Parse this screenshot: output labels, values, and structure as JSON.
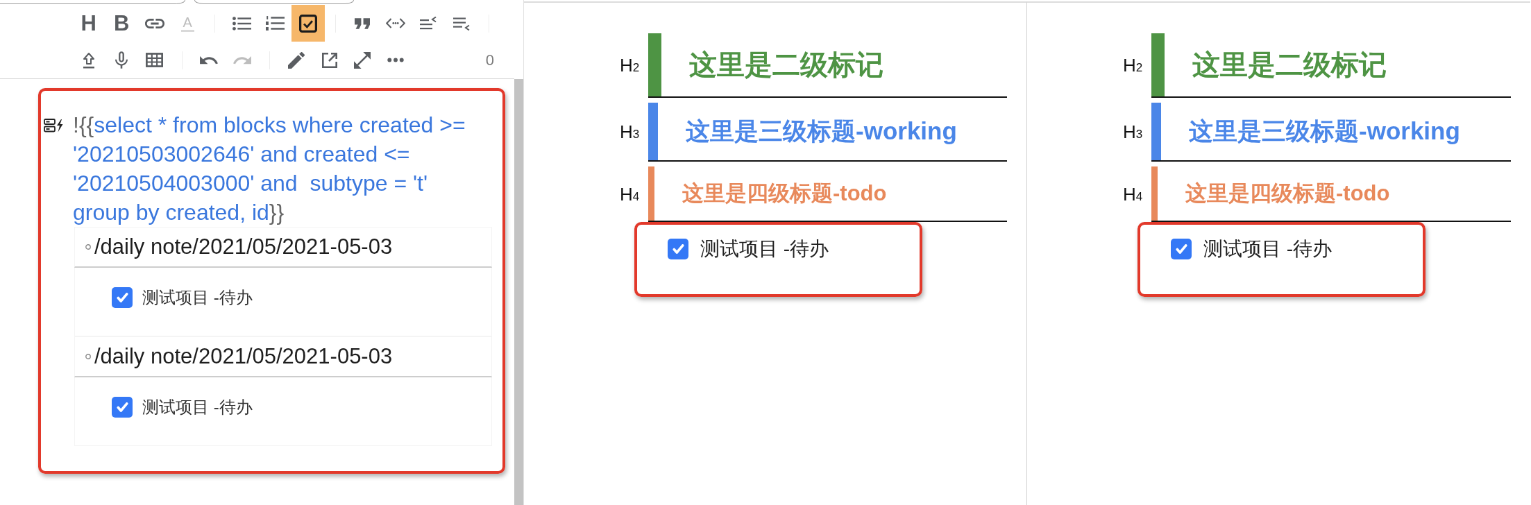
{
  "editor": {
    "toolbar": {
      "rows": [
        [
          [
            {
              "label": "H",
              "on": false,
              "disabled": false
            },
            {
              "label": "B",
              "on": false,
              "disabled": false
            },
            {
              "on": false,
              "disabled": false
            },
            {
              "label": "A",
              "on": false,
              "disabled": true
            }
          ],
          [
            {
              "on": false,
              "disabled": false
            },
            {
              "on": false,
              "disabled": false
            },
            {
              "on": true,
              "disabled": false
            }
          ],
          [
            {
              "on": false,
              "disabled": false
            },
            {
              "on": false,
              "disabled": false
            },
            {
              "on": false,
              "disabled": false
            },
            {
              "on": false,
              "disabled": false
            }
          ]
        ],
        [
          [
            {
              "on": false,
              "disabled": false
            },
            {
              "on": false,
              "disabled": false
            },
            {
              "on": false,
              "disabled": false
            }
          ],
          [
            {
              "on": false,
              "disabled": false
            },
            {
              "on": false,
              "disabled": true
            }
          ],
          [
            {
              "on": false,
              "disabled": false
            },
            {
              "on": false,
              "disabled": false
            },
            {
              "on": false,
              "disabled": false
            },
            {
              "on": false,
              "disabled": false
            }
          ]
        ]
      ],
      "counter": "0"
    },
    "query_block": {
      "highlighted": true,
      "embed_open": "!{{",
      "query": "select * from blocks where created >= '20210503002646' and created <= '20210504003000' and  subtype = 't' group by created, id",
      "embed_close": "}}",
      "results": [
        {
          "path": "/daily note/2021/05/2021-05-03",
          "tasks": [
            {
              "text": "测试项目 -待办",
              "checked": true
            }
          ]
        },
        {
          "path": "/daily note/2021/05/2021-05-03",
          "tasks": [
            {
              "text": "测试项目 -待办",
              "checked": true
            }
          ]
        }
      ]
    }
  },
  "previews": [
    {
      "headings": [
        {
          "kind": "h2",
          "marker": "H$_{2}$",
          "text": "这里是二级标记",
          "color": "#4e9444"
        },
        {
          "kind": "h3",
          "marker": "H$_{3}$",
          "text": "这里是三级标题-working",
          "color": "#4a86e8"
        },
        {
          "kind": "h4",
          "marker": "H$_{4}$",
          "text": "这里是四级标题-todo",
          "color": "#e8895b"
        }
      ],
      "task": {
        "text": "测试项目 -待办",
        "checked": true,
        "highlighted": true
      }
    },
    {
      "headings": [
        {
          "kind": "h2",
          "marker": "H$_{2}$",
          "text": "这里是二级标记",
          "color": "#4e9444"
        },
        {
          "kind": "h3",
          "marker": "H$_{3}$",
          "text": "这里是三级标题-working",
          "color": "#4a86e8"
        },
        {
          "kind": "h4",
          "marker": "H$_{4}$",
          "text": "这里是四级标题-todo",
          "color": "#e8895b"
        }
      ],
      "task": {
        "text": "测试项目 -待办",
        "checked": true,
        "highlighted": true
      }
    }
  ]
}
